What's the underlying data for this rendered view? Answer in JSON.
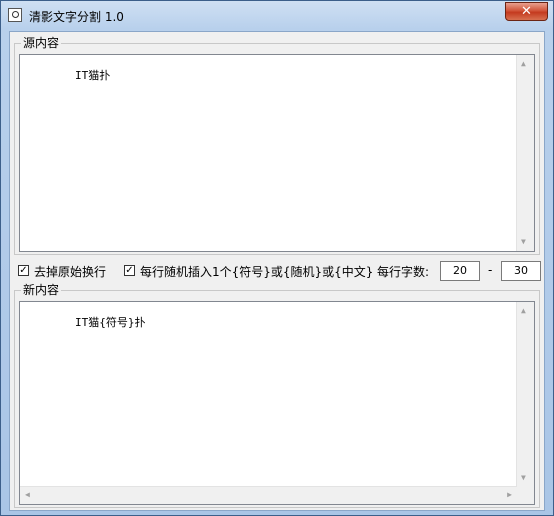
{
  "window": {
    "title": "清影文字分割 1.0",
    "close_glyph": "✕"
  },
  "source_group": {
    "label": "源内容",
    "content": "IT猫扑"
  },
  "options": {
    "remove_newlines": {
      "label": "去掉原始换行",
      "checked": true,
      "mark": "✓"
    },
    "insert_random": {
      "label": "每行随机插入1个{符号}或{随机}或{中文}",
      "checked": true,
      "mark": "✓"
    },
    "chars_per_line_label": "每行字数:",
    "min_value": "20",
    "separator": "-",
    "max_value": "30"
  },
  "result_group": {
    "label": "新内容",
    "content": "IT猫{符号}扑"
  },
  "scroll_arrows": {
    "up": "▲",
    "down": "▼",
    "left": "◀",
    "right": "▶"
  }
}
